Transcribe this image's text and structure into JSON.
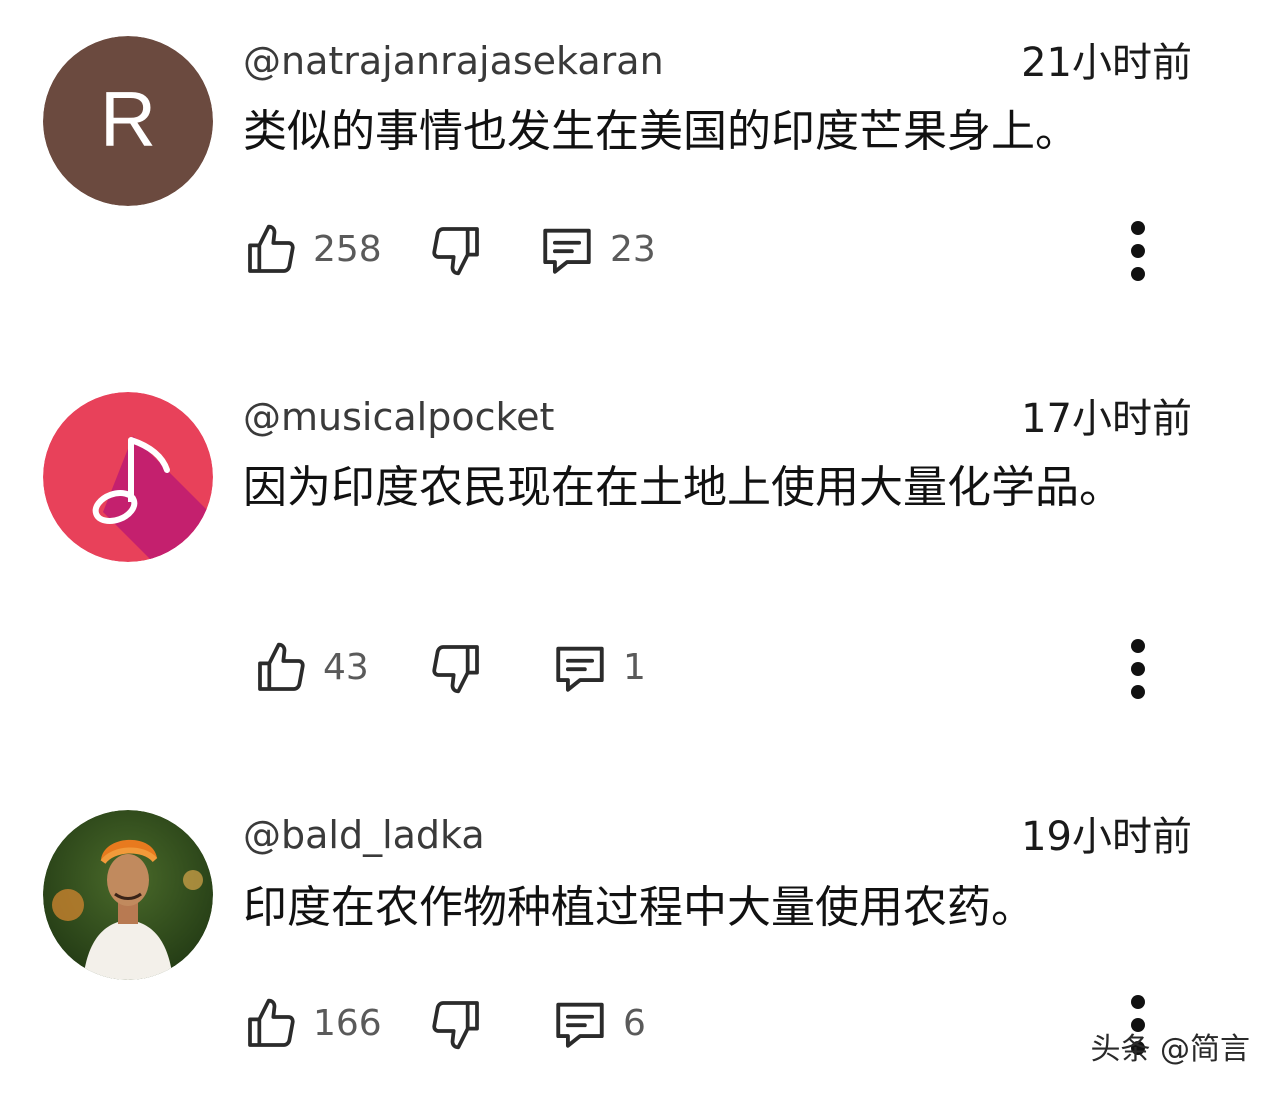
{
  "comments": [
    {
      "username": "@natrajanrajasekaran",
      "time": "21小时前",
      "text": "类似的事情也发生在美国的印度芒果身上。",
      "avatar_letter": "R",
      "avatar_color": "#6b4a3f",
      "likes": "258",
      "replies": "23"
    },
    {
      "username": "@musicalpocket",
      "time": "17小时前",
      "text": "因为印度农民现在在土地上使用大量化学品。",
      "avatar_icon": "music-note-icon",
      "avatar_color": "#e8415a",
      "likes": "43",
      "replies": "1"
    },
    {
      "username": "@bald_ladka",
      "time": "19小时前",
      "text": "印度在农作物种植过程中大量使用农药。",
      "avatar_icon": "person-photo",
      "likes": "166",
      "replies": "6"
    }
  ],
  "watermark": "头条 @简言"
}
